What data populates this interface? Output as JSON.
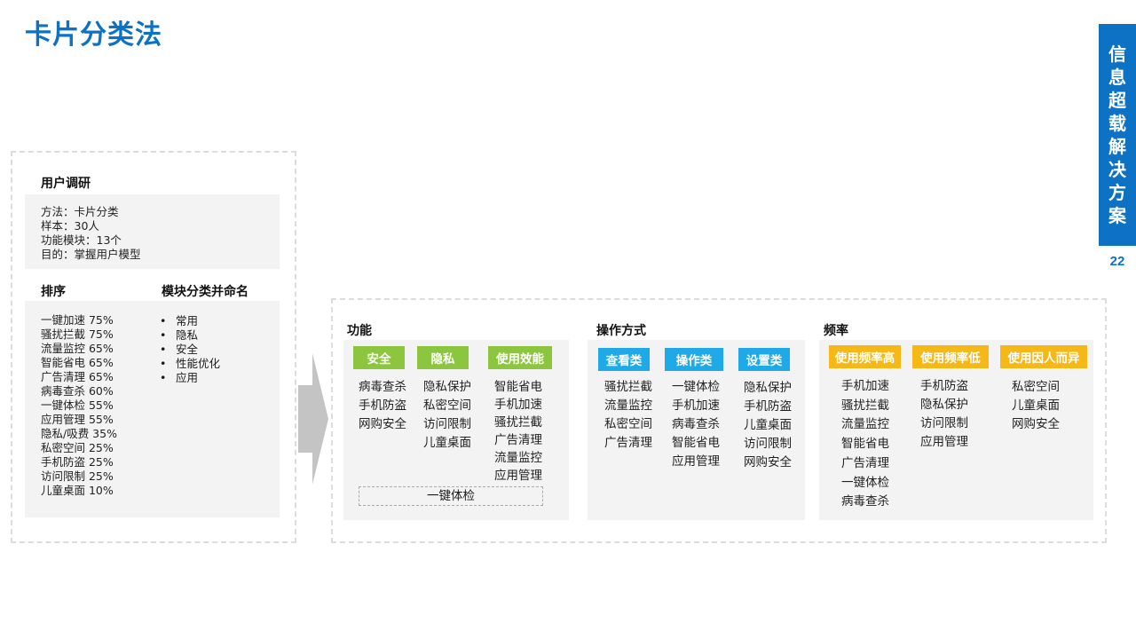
{
  "page": {
    "title": "卡片分类法",
    "side_title": [
      "信",
      "息",
      "超",
      "载",
      "解",
      "决",
      "方",
      "案"
    ],
    "page_number": "22"
  },
  "research": {
    "header": "用户调研",
    "details": [
      "方法：卡片分类",
      "样本：30人",
      "功能模块：13个",
      "目的：掌握用户模型"
    ]
  },
  "ranking": {
    "header": "排序",
    "items": [
      "一键加速 75%",
      "骚扰拦截 75%",
      "流量监控 65%",
      "智能省电 65%",
      "广告清理 65%",
      "病毒查杀 60%",
      "一键体检 55%",
      "应用管理 55%",
      "隐私/吸费 35%",
      "私密空间 25%",
      "手机防盗 25%",
      "访问限制 25%",
      "儿童桌面 10%"
    ]
  },
  "naming": {
    "header": "模块分类并命名",
    "items": [
      "常用",
      "隐私",
      "安全",
      "性能优化",
      "应用"
    ]
  },
  "groups": {
    "function": {
      "header": "功能",
      "categories": [
        {
          "label": "安全",
          "items": [
            "病毒查杀",
            "手机防盗",
            "网购安全"
          ]
        },
        {
          "label": "隐私",
          "items": [
            "隐私保护",
            "私密空间",
            "访问限制",
            "儿童桌面"
          ]
        },
        {
          "label": "使用效能",
          "items": [
            "智能省电",
            "手机加速",
            "骚扰拦截",
            "广告清理",
            "流量监控",
            "应用管理"
          ]
        }
      ],
      "footer": "一键体检"
    },
    "operation": {
      "header": "操作方式",
      "categories": [
        {
          "label": "查看类",
          "items": [
            "骚扰拦截",
            "流量监控",
            "私密空间",
            "广告清理"
          ]
        },
        {
          "label": "操作类",
          "items": [
            "一键体检",
            "手机加速",
            "病毒查杀",
            "智能省电",
            "应用管理"
          ]
        },
        {
          "label": "设置类",
          "items": [
            "隐私保护",
            "手机防盗",
            "儿童桌面",
            "访问限制",
            "网购安全"
          ]
        }
      ]
    },
    "frequency": {
      "header": "频率",
      "categories": [
        {
          "label": "使用频率高",
          "items": [
            "手机加速",
            "骚扰拦截",
            "流量监控",
            "智能省电",
            "广告清理",
            "一键体检",
            "病毒查杀"
          ]
        },
        {
          "label": "使用频率低",
          "items": [
            "手机防盗",
            "隐私保护",
            "访问限制",
            "应用管理"
          ]
        },
        {
          "label": "使用因人而异",
          "items": [
            "私密空间",
            "儿童桌面",
            "网购安全"
          ]
        }
      ]
    }
  },
  "colors": {
    "brand_blue": "#0d72c4",
    "green": "#8cc63f",
    "cyan": "#1fa9e6",
    "yellow": "#f6b817",
    "panel_grey": "#f3f3f3"
  }
}
